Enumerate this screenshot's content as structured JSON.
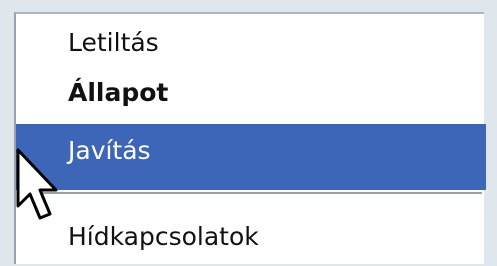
{
  "context_menu": {
    "items": [
      {
        "label": "Letiltás",
        "state": "normal"
      },
      {
        "label": "Állapot",
        "state": "default"
      },
      {
        "label": "Javítás",
        "state": "highlighted"
      },
      {
        "label": "Hídkapcsolatok",
        "state": "normal"
      }
    ]
  },
  "colors": {
    "highlight": "#3d66b8",
    "menu_background": "#ffffff",
    "text": "#111111",
    "highlight_text": "#ffffff"
  },
  "cursor": {
    "icon": "arrow-pointer-icon"
  }
}
